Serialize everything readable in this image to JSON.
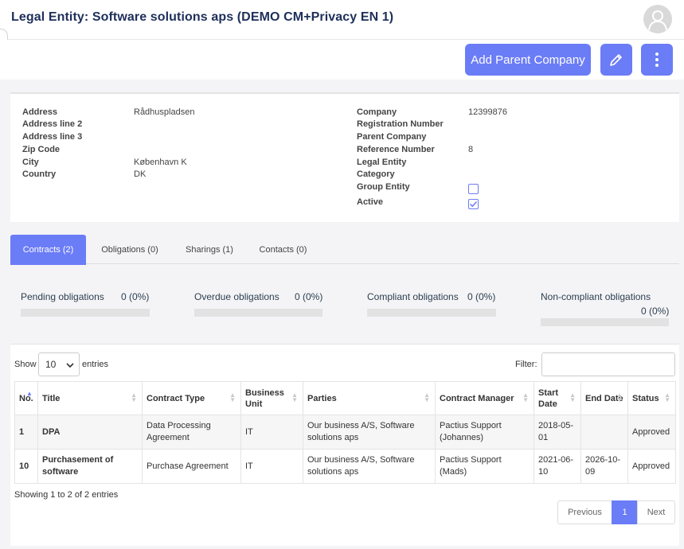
{
  "header": {
    "title": "Legal Entity: Software solutions aps (DEMO CM+Privacy EN 1)"
  },
  "toolbar": {
    "add_parent_label": "Add Parent Company"
  },
  "address": {
    "address_label": "Address",
    "address_value": "Rådhuspladsen",
    "line2_label": "Address line 2",
    "line2_value": "",
    "line3_label": "Address line 3",
    "line3_value": "",
    "zip_label": "Zip Code",
    "zip_value": "",
    "city_label": "City",
    "city_value": "København K",
    "country_label": "Country",
    "country_value": "DK"
  },
  "company": {
    "company_label": "Company",
    "company_value": "12399876",
    "regnum_label": "Registration Number",
    "parent_label": "Parent Company",
    "refnum_label": "Reference Number",
    "refnum_value": "8",
    "legal_label": "Legal Entity",
    "category_label": "Category",
    "group_label": "Group Entity",
    "group_checked": false,
    "active_label": "Active",
    "active_checked": true
  },
  "tabs": [
    {
      "label": "Contracts (2)",
      "active": true
    },
    {
      "label": "Obligations (0)",
      "active": false
    },
    {
      "label": "Sharings (1)",
      "active": false
    },
    {
      "label": "Contacts (0)",
      "active": false
    }
  ],
  "obligations": [
    {
      "label": "Pending obligations",
      "value": "0 (0%)",
      "progress": 0
    },
    {
      "label": "Overdue obligations",
      "value": "0 (0%)",
      "progress": 0
    },
    {
      "label": "Compliant obligations",
      "value": "0 (0%)",
      "progress": 0
    },
    {
      "label": "Non-compliant obligations",
      "value": "0 (0%)",
      "progress": 0
    }
  ],
  "table": {
    "show_label": "Show",
    "entries_value": "10",
    "entries_label": "entries",
    "filter_label": "Filter:",
    "columns": [
      "No.",
      "Title",
      "Contract Type",
      "Business Unit",
      "Parties",
      "Contract Manager",
      "Start Date",
      "End Date",
      "Status"
    ],
    "rows": [
      [
        "1",
        "DPA",
        "Data Processing Agreement",
        "IT",
        "Our business A/S, Software solutions aps",
        "Pactius Support (Johannes)",
        "2018-05-01",
        "",
        "Approved"
      ],
      [
        "10",
        "Purchasement of software",
        "Purchase Agreement",
        "IT",
        "Our business A/S, Software solutions aps",
        "Pactius Support (Mads)",
        "2021-06-10",
        "2026-10-09",
        "Approved"
      ]
    ],
    "info": "Showing 1 to 2 of 2 entries",
    "pager": {
      "previous": "Previous",
      "current": "1",
      "next": "Next"
    }
  },
  "colors": {
    "accent": "#6b7cf7",
    "title": "#1e2f5a"
  }
}
